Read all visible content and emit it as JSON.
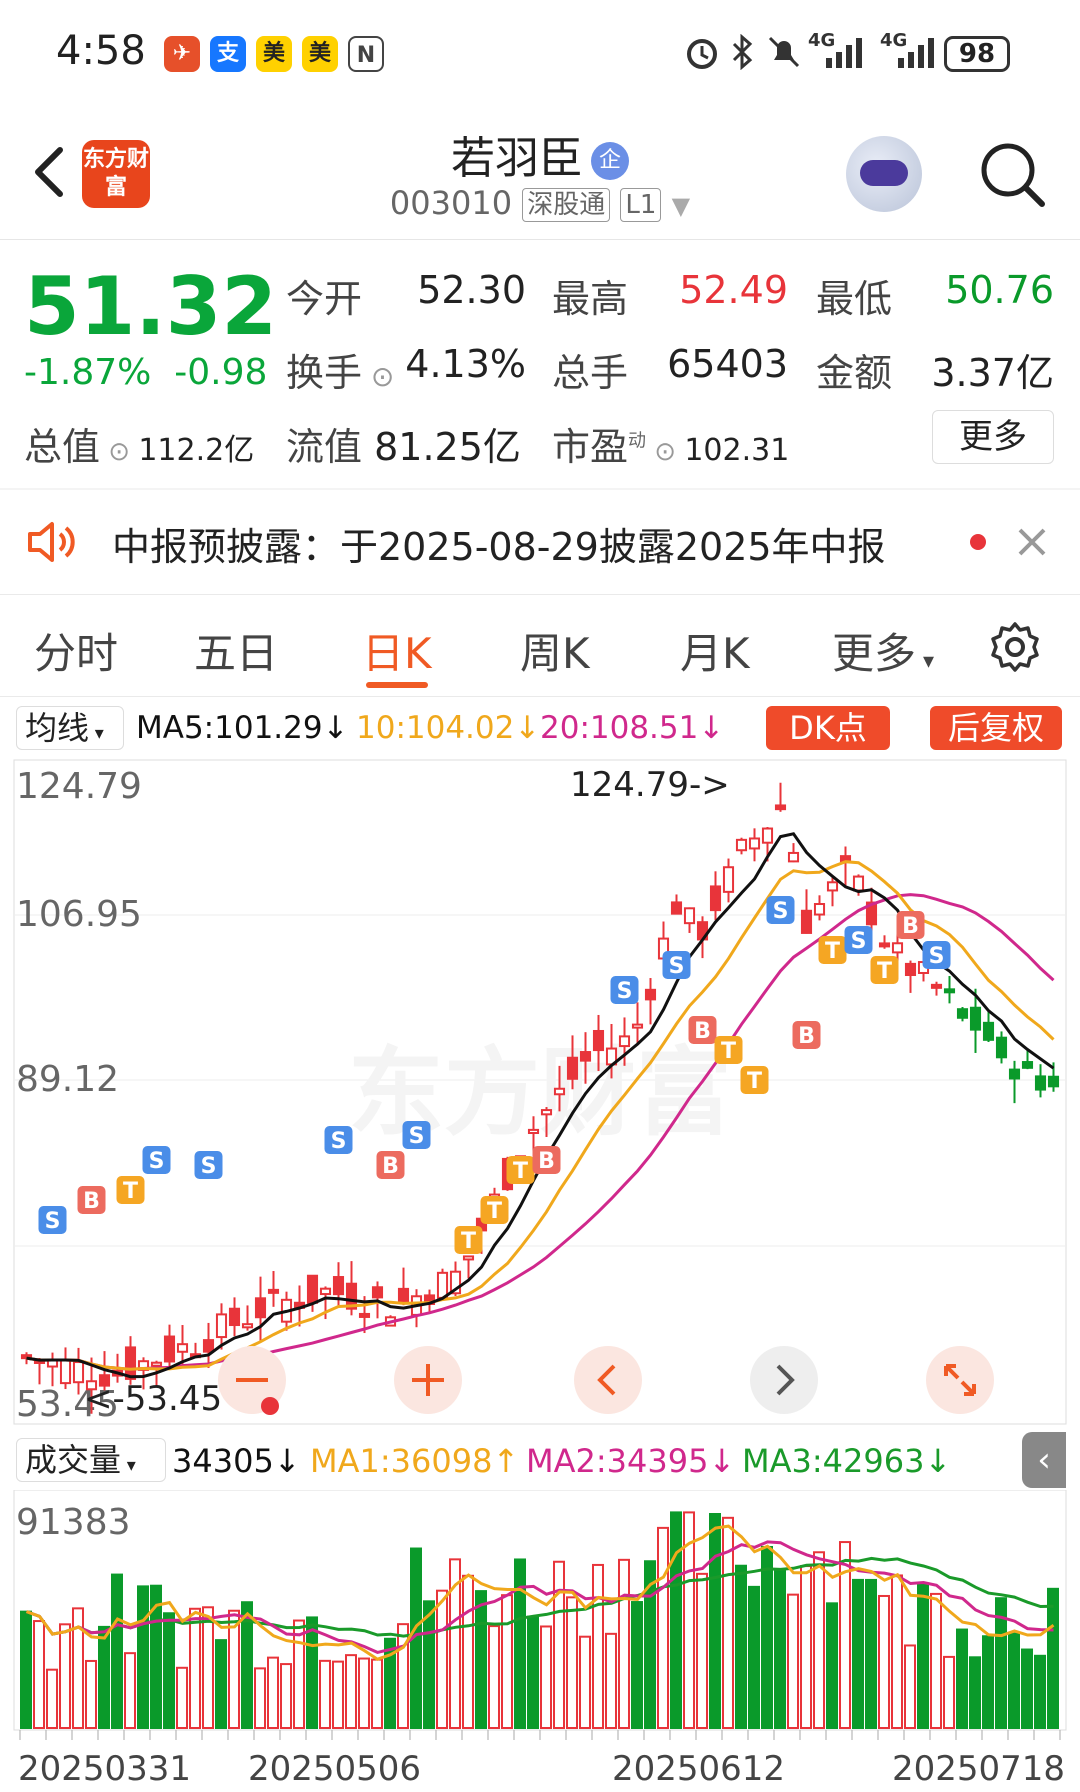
{
  "status_bar": {
    "time": "4:58",
    "app_icons": [
      "支",
      "美",
      "美",
      "N"
    ],
    "network": [
      "4G",
      "4G"
    ],
    "battery": "98"
  },
  "header": {
    "logo_text": "东方财富",
    "stock_name": "若羽臣",
    "badge": "企",
    "code": "003010",
    "tag1": "深股通",
    "tag2": "L1"
  },
  "quote": {
    "price": "51.32",
    "pct": "-1.87%",
    "change": "-0.98",
    "open_label": "今开",
    "open": "52.30",
    "high_label": "最高",
    "high": "52.49",
    "low_label": "最低",
    "low": "50.76",
    "turnover_label": "换手",
    "turnover": "4.13%",
    "vol_label": "总手",
    "vol": "65403",
    "amount_label": "金额",
    "amount": "3.37亿",
    "mcap_label": "总值",
    "mcap": "112.2亿",
    "float_label": "流值",
    "float": "81.25亿",
    "pe_label": "市盈",
    "pe_sup": "动",
    "pe": "102.31",
    "more": "更多"
  },
  "notice": {
    "text": "中报预披露：于2025-08-29披露2025年中报"
  },
  "tabs": [
    "分时",
    "五日",
    "日K",
    "周K",
    "月K",
    "更多"
  ],
  "active_tab": "日K",
  "ma_bar": {
    "dropdown": "均线",
    "ma5": "MA5:101.29↓",
    "ma10": "10:104.02↓",
    "ma20": "20:108.51↓",
    "dk": "DK点",
    "fuquan": "后复权"
  },
  "kline": {
    "y_labels": [
      "124.79",
      "106.95",
      "89.12",
      "53.45"
    ],
    "max_label": "124.79->",
    "min_label": "<-53.45",
    "watermark": "东方财富"
  },
  "vol_bar": {
    "dropdown": "成交量",
    "vol": "34305↓",
    "ma1": "MA1:36098↑",
    "ma2": "MA2:34395↓",
    "ma3": "MA3:42963↓"
  },
  "volume": {
    "y_label": "91383"
  },
  "dates": [
    "20250331",
    "20250506",
    "20250612",
    "20250718"
  ],
  "colors": {
    "up": "#e8343a",
    "down": "#0a9a2a",
    "accent": "#f05a24",
    "ma5": "#111111",
    "ma10": "#f0a81c",
    "ma20": "#d0288c",
    "ma3": "#1a9a2a"
  }
}
